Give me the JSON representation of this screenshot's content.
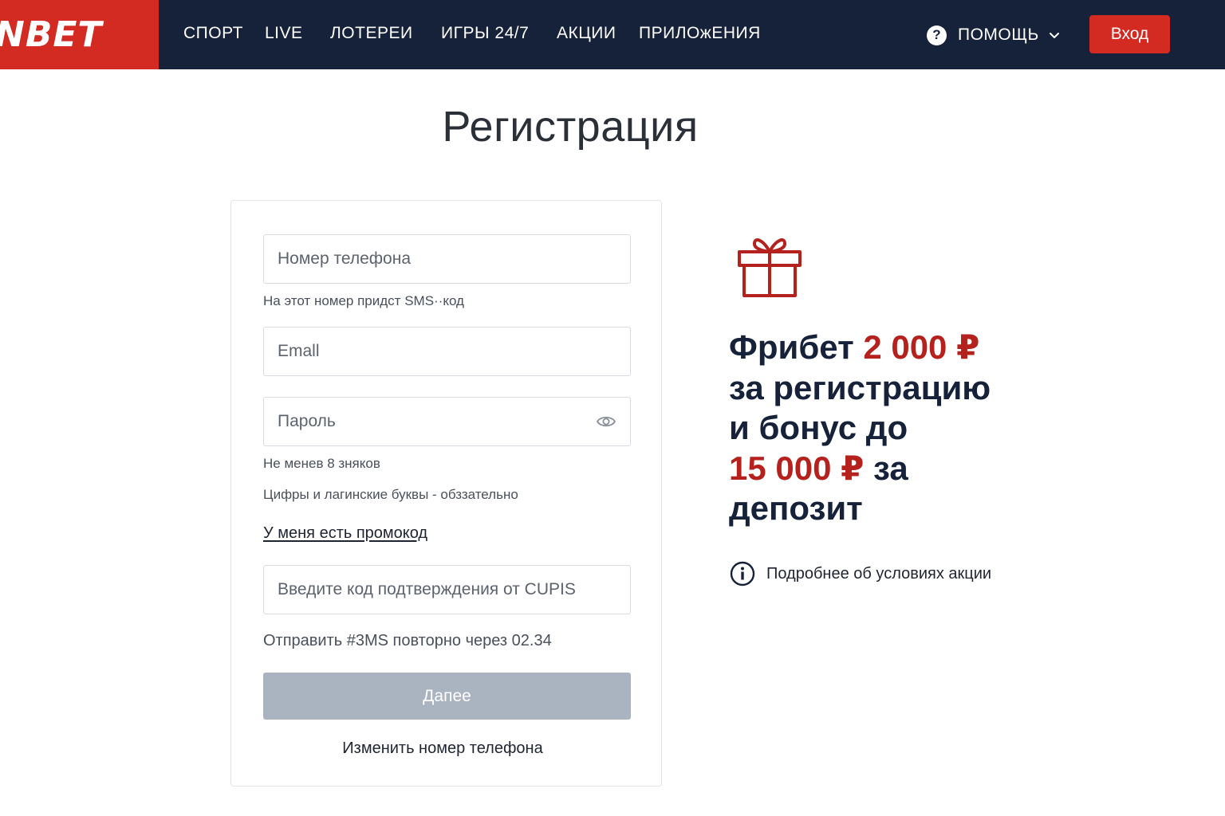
{
  "header": {
    "logo_text": "NBET",
    "nav": [
      "СПОРТ",
      "LIVE",
      "ЛОТЕРЕИ",
      "ИГРЫ 24/7",
      "АКЦИИ",
      "ПРИЛОжЕНИЯ"
    ],
    "help_label": "ПОМОЩЬ",
    "login_label": "Вход"
  },
  "page_title": "Регистрация",
  "form": {
    "phone_placeholder": "Номер телефона",
    "phone_hint": "На этот номер придст SMS··код",
    "email_placeholder": "Emall",
    "password_placeholder": "Пароль",
    "password_hint_1": "Не менев 8 зняков",
    "password_hint_2": "Цифры и лагинские буквы - обззательно",
    "promo_link": "У меня есть пpомокод",
    "cupis_placeholder": "Введите код подтверждения от CUPIS",
    "resend_text": "Отправить #3MS повторно через 02.34",
    "next_label": "Дапее",
    "change_phone": "Изменить номер телефона"
  },
  "promo": {
    "line1_prefix": "Фрибет ",
    "line1_amount": "2 000 ₽",
    "line2": "за регистрацию",
    "line3": "и бонус до",
    "line4_amount": "15 000 ₽",
    "line4_suffix": " за",
    "line5": "депозит",
    "conditions_link": "Подробнее об условиях акции"
  },
  "colors": {
    "brand_red": "#d32a22",
    "header_bg": "#16213a",
    "accent_red_text": "#b5211c",
    "disabled_button": "#a9b4c0"
  },
  "icons": {
    "help": "question-circle-icon",
    "dropdown": "chevron-down-icon",
    "password_toggle": "eye-icon",
    "promo": "gift-icon",
    "info": "info-circle-icon"
  }
}
